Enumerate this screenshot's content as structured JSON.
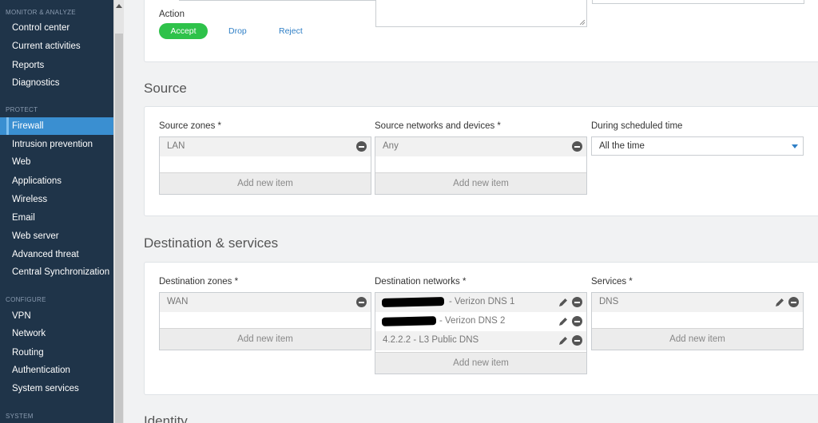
{
  "sidebar": {
    "monitor_header": "MONITOR & ANALYZE",
    "monitor_items": [
      "Control center",
      "Current activities",
      "Reports",
      "Diagnostics"
    ],
    "protect_header": "PROTECT",
    "protect_items": [
      "Firewall",
      "Intrusion prevention",
      "Web",
      "Applications",
      "Wireless",
      "Email",
      "Web server",
      "Advanced threat",
      "Central Synchronization"
    ],
    "active_item": "Firewall",
    "configure_header": "CONFIGURE",
    "configure_items": [
      "VPN",
      "Network",
      "Routing",
      "Authentication",
      "System services"
    ],
    "system_header": "SYSTEM"
  },
  "action": {
    "label": "Action",
    "accept": "Accept",
    "drop": "Drop",
    "reject": "Reject"
  },
  "source": {
    "title": "Source",
    "zones_label": "Source zones *",
    "zones": [
      "LAN"
    ],
    "networks_label": "Source networks and devices *",
    "networks": [
      "Any"
    ],
    "schedule_label": "During scheduled time",
    "schedule_value": "All the time",
    "add_new_item": "Add new item"
  },
  "destination": {
    "title": "Destination & services",
    "zones_label": "Destination zones *",
    "zones": [
      "WAN"
    ],
    "networks_label": "Destination networks *",
    "networks": [
      "- Verizon DNS 1",
      "- Verizon DNS 2",
      "4.2.2.2 - L3 Public DNS"
    ],
    "services_label": "Services *",
    "services": [
      "DNS"
    ],
    "add_new_item": "Add new item"
  },
  "identity": {
    "title": "Identity"
  },
  "colors": {
    "sidebar_bg": "#1f3449",
    "active_item": "#3a8fd1",
    "accept_green": "#2ec24a",
    "link_blue": "#2f7fc6"
  }
}
